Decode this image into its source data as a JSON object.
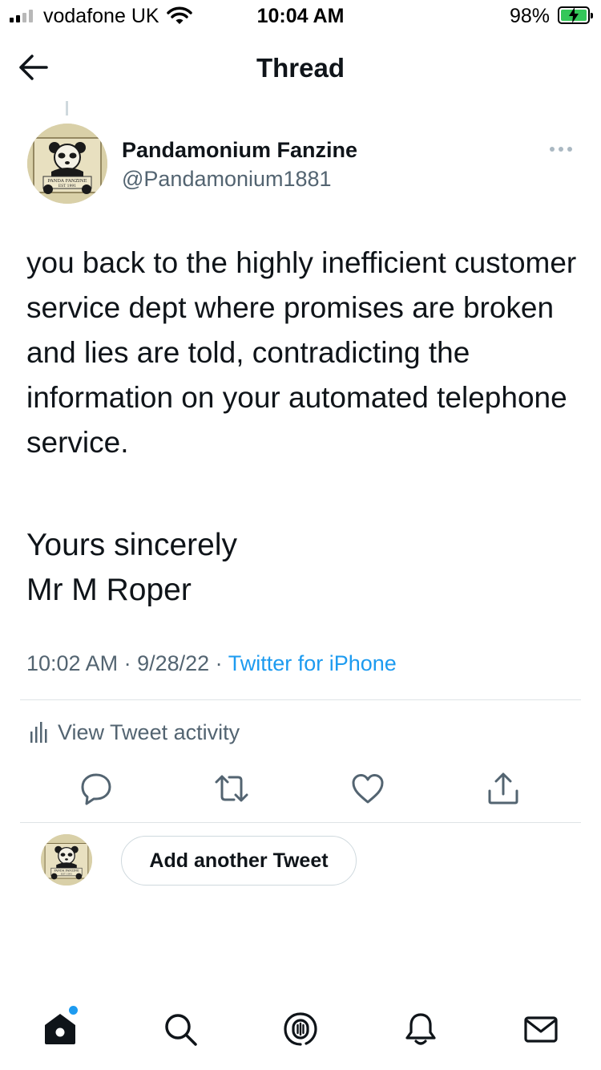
{
  "status_bar": {
    "carrier": "vodafone UK",
    "time": "10:04 AM",
    "battery_percent": "98%",
    "signal_bars_filled": 2,
    "signal_bars_total": 4,
    "charging": true
  },
  "header": {
    "title": "Thread",
    "back_icon": "arrow-left-icon"
  },
  "tweet": {
    "author_name": "Pandamonium Fanzine",
    "author_handle": "@Pandamonium1881",
    "avatar_text": [
      "PANDA FANZINE",
      "EST 1991"
    ],
    "text": "you back to the highly inefficient customer service dept where promises are broken and lies are told, contradicting the information on your automated telephone service.",
    "signoff": [
      "Yours sincerely",
      "Mr M Roper"
    ],
    "time": "10:02 AM",
    "separator": " · ",
    "date": "9/28/22",
    "source": "Twitter for iPhone",
    "activity_label": "View Tweet activity"
  },
  "actions": [
    "reply-icon",
    "retweet-icon",
    "like-icon",
    "share-icon"
  ],
  "reply_bar": {
    "button_label": "Add another Tweet"
  },
  "tabbar": [
    "home-icon",
    "search-icon",
    "spaces-icon",
    "notifications-icon",
    "messages-icon"
  ],
  "colors": {
    "text": "#0f1419",
    "secondary": "#536471",
    "accent": "#1d9bf0",
    "divider": "#dfe3e6"
  }
}
